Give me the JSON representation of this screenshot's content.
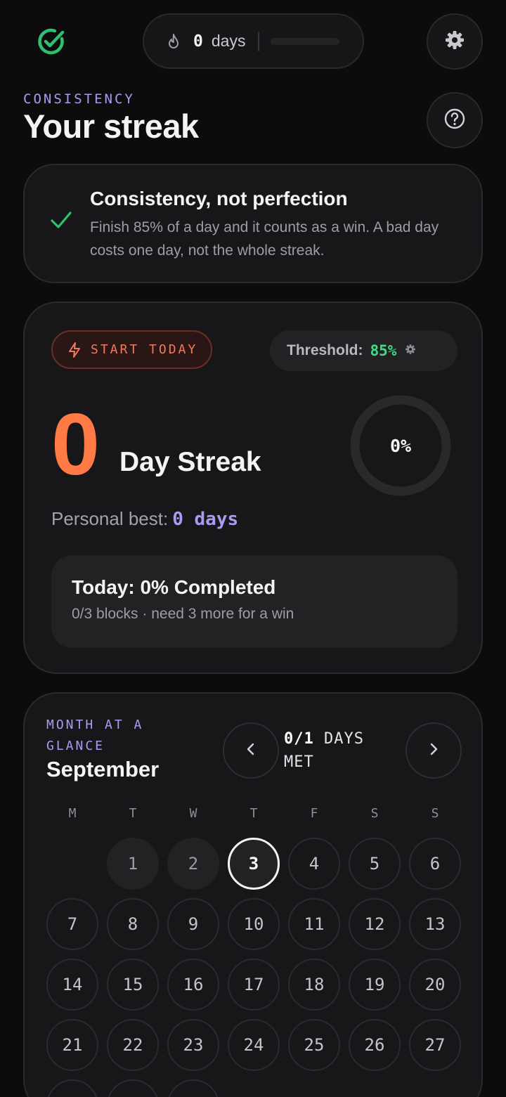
{
  "topbar": {
    "streak_count": "0",
    "streak_unit": "days"
  },
  "header": {
    "eyebrow": "CONSISTENCY",
    "title": "Your streak"
  },
  "note": {
    "title": "Consistency, not perfection",
    "body": "Finish 85% of a day and it counts as a win. A bad day costs one day, not the whole streak."
  },
  "streak": {
    "badge": "START TODAY",
    "threshold_label": "Threshold:",
    "threshold_value": "85%",
    "count": "0",
    "count_label": "Day Streak",
    "progress_percent": 0,
    "progress_label": "0%",
    "best_label": "Personal best:",
    "best_value": "0 days",
    "today_title": "Today: 0% Completed",
    "today_sub": "0/3 blocks · need 3 more for a win"
  },
  "month": {
    "eyebrow": "MONTH AT A GLANCE",
    "name": "September",
    "met_count": "0/1",
    "met_label": " DAYS MET",
    "weekdays": [
      "M",
      "T",
      "W",
      "T",
      "F",
      "S",
      "S"
    ],
    "start_offset": 1,
    "days_in_month": 30,
    "today": 3,
    "past_days": [
      1,
      2
    ]
  },
  "colors": {
    "accent": "#a89cf0",
    "streak_orange": "#ff7a45",
    "success_green": "#3ddc84",
    "background": "#0c0c0d",
    "card": "#17171a"
  },
  "icons": {
    "logo": "check-circle-icon",
    "flame": "flame-icon",
    "settings": "gear-icon",
    "help": "help-circle-icon",
    "bolt": "bolt-icon",
    "prev": "chevron-left-icon",
    "next": "chevron-right-icon"
  }
}
